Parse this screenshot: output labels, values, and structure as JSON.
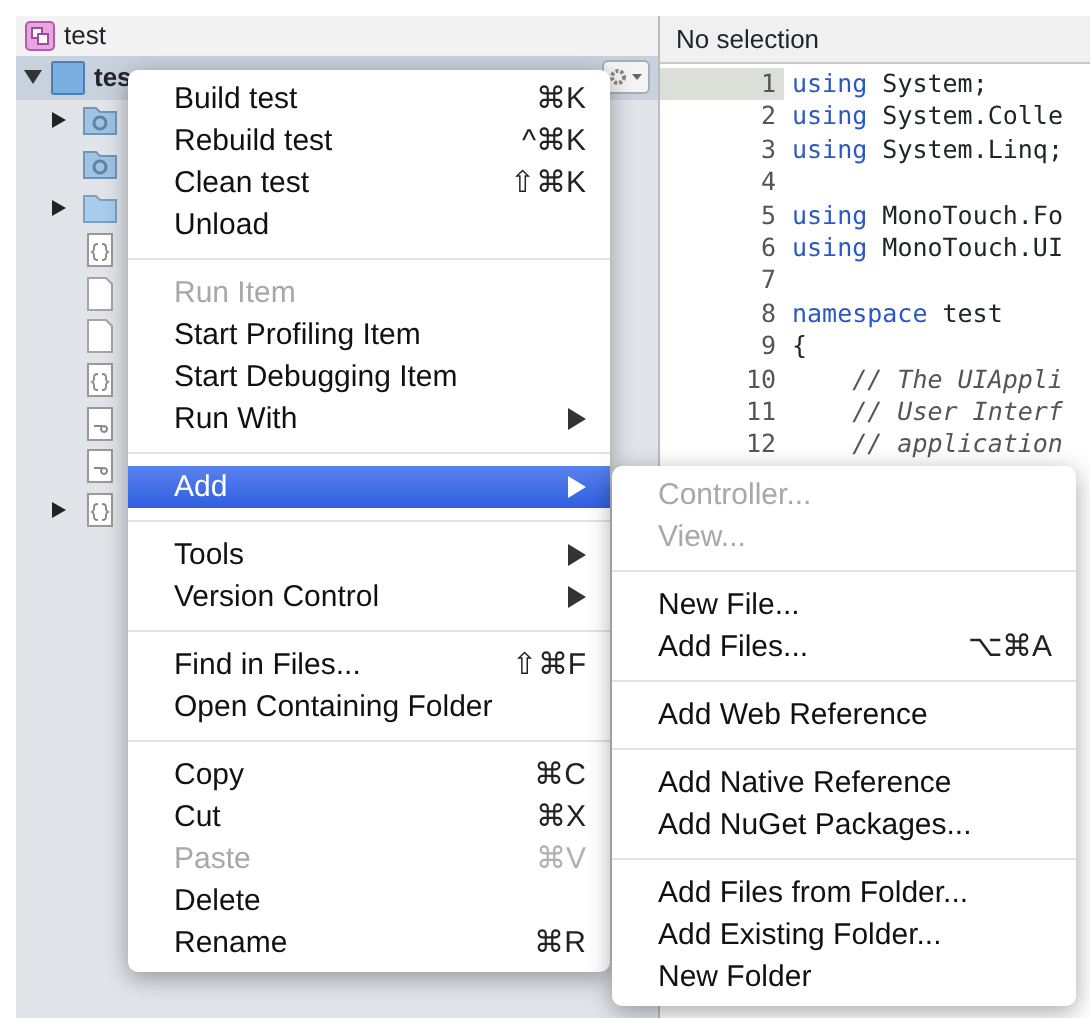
{
  "solution": {
    "title": "test"
  },
  "tree": {
    "root": {
      "label": "tes",
      "expanded": true,
      "selected": true
    },
    "items": [
      {
        "kind": "gear-folder",
        "expandable": true
      },
      {
        "kind": "gear-folder",
        "expandable": false
      },
      {
        "kind": "folder",
        "expandable": true
      },
      {
        "kind": "code-file",
        "expandable": false
      },
      {
        "kind": "file",
        "expandable": false
      },
      {
        "kind": "file",
        "expandable": false
      },
      {
        "kind": "code-file",
        "expandable": false
      },
      {
        "kind": "storyboard-file",
        "expandable": false
      },
      {
        "kind": "storyboard-file",
        "expandable": false
      },
      {
        "kind": "code-file",
        "expandable": true
      }
    ]
  },
  "editor": {
    "header": "No selection",
    "lines": [
      {
        "number": "1",
        "current": true,
        "tokens": [
          {
            "kind": "keyword",
            "text": "using"
          },
          {
            "kind": "plain",
            "text": " System;"
          }
        ]
      },
      {
        "number": "2",
        "current": false,
        "tokens": [
          {
            "kind": "keyword",
            "text": "using"
          },
          {
            "kind": "plain",
            "text": " System.Colle"
          }
        ]
      },
      {
        "number": "3",
        "current": false,
        "tokens": [
          {
            "kind": "keyword",
            "text": "using"
          },
          {
            "kind": "plain",
            "text": " System.Linq;"
          }
        ]
      },
      {
        "number": "4",
        "current": false
      },
      {
        "number": "5",
        "current": false,
        "tokens": [
          {
            "kind": "keyword",
            "text": "using"
          },
          {
            "kind": "plain",
            "text": " MonoTouch.Fo"
          }
        ]
      },
      {
        "number": "6",
        "current": false,
        "tokens": [
          {
            "kind": "keyword",
            "text": "using"
          },
          {
            "kind": "plain",
            "text": " MonoTouch.UI"
          }
        ]
      },
      {
        "number": "7",
        "current": false
      },
      {
        "number": "8",
        "current": false,
        "tokens": [
          {
            "kind": "keyword",
            "text": "namespace"
          },
          {
            "kind": "plain",
            "text": " test"
          }
        ]
      },
      {
        "number": "9",
        "current": false,
        "tokens": [
          {
            "kind": "plain",
            "text": "{"
          }
        ]
      },
      {
        "number": "10",
        "current": false,
        "tokens": [
          {
            "kind": "comment",
            "text": "    // The UIAppli"
          }
        ]
      },
      {
        "number": "11",
        "current": false,
        "tokens": [
          {
            "kind": "comment",
            "text": "    // User Interf"
          }
        ]
      },
      {
        "number": "12",
        "current": false,
        "tokens": [
          {
            "kind": "comment",
            "text": "    // application"
          }
        ]
      }
    ]
  },
  "context_menu": {
    "sections": [
      [
        {
          "label": "Build test",
          "shortcut": "⌘K",
          "disabled": false,
          "submenu": false,
          "selected": false
        },
        {
          "label": "Rebuild test",
          "shortcut": "^⌘K",
          "disabled": false,
          "submenu": false,
          "selected": false
        },
        {
          "label": "Clean test",
          "shortcut": "⇧⌘K",
          "disabled": false,
          "submenu": false,
          "selected": false
        },
        {
          "label": "Unload",
          "disabled": false,
          "submenu": false,
          "selected": false
        }
      ],
      [
        {
          "label": "Run Item",
          "disabled": true,
          "submenu": false,
          "selected": false
        },
        {
          "label": "Start Profiling Item",
          "disabled": false,
          "submenu": false,
          "selected": false
        },
        {
          "label": "Start Debugging Item",
          "disabled": false,
          "submenu": false,
          "selected": false
        },
        {
          "label": "Run With",
          "disabled": false,
          "submenu": true,
          "selected": false
        }
      ],
      [
        {
          "label": "Add",
          "disabled": false,
          "submenu": true,
          "selected": true
        }
      ],
      [
        {
          "label": "Tools",
          "disabled": false,
          "submenu": true,
          "selected": false
        },
        {
          "label": "Version Control",
          "disabled": false,
          "submenu": true,
          "selected": false
        }
      ],
      [
        {
          "label": "Find in Files...",
          "shortcut": "⇧⌘F",
          "disabled": false,
          "submenu": false,
          "selected": false
        },
        {
          "label": "Open Containing Folder",
          "disabled": false,
          "submenu": false,
          "selected": false
        }
      ],
      [
        {
          "label": "Copy",
          "shortcut": "⌘C",
          "disabled": false,
          "submenu": false,
          "selected": false
        },
        {
          "label": "Cut",
          "shortcut": "⌘X",
          "disabled": false,
          "submenu": false,
          "selected": false
        },
        {
          "label": "Paste",
          "shortcut": "⌘V",
          "disabled": true,
          "submenu": false,
          "selected": false
        },
        {
          "label": "Delete",
          "disabled": false,
          "submenu": false,
          "selected": false
        },
        {
          "label": "Rename",
          "shortcut": "⌘R",
          "disabled": false,
          "submenu": false,
          "selected": false
        }
      ]
    ]
  },
  "add_submenu": {
    "sections": [
      [
        {
          "label": "Controller...",
          "disabled": true
        },
        {
          "label": "View...",
          "disabled": true
        }
      ],
      [
        {
          "label": "New File...",
          "disabled": false
        },
        {
          "label": "Add Files...",
          "shortcut": "⌥⌘A",
          "disabled": false
        }
      ],
      [
        {
          "label": "Add Web Reference",
          "disabled": false
        }
      ],
      [
        {
          "label": "Add Native Reference",
          "disabled": false
        },
        {
          "label": "Add NuGet Packages...",
          "disabled": false
        }
      ],
      [
        {
          "label": "Add Files from Folder...",
          "disabled": false
        },
        {
          "label": "Add Existing Folder...",
          "disabled": false
        },
        {
          "label": "New Folder",
          "disabled": false
        }
      ]
    ]
  }
}
